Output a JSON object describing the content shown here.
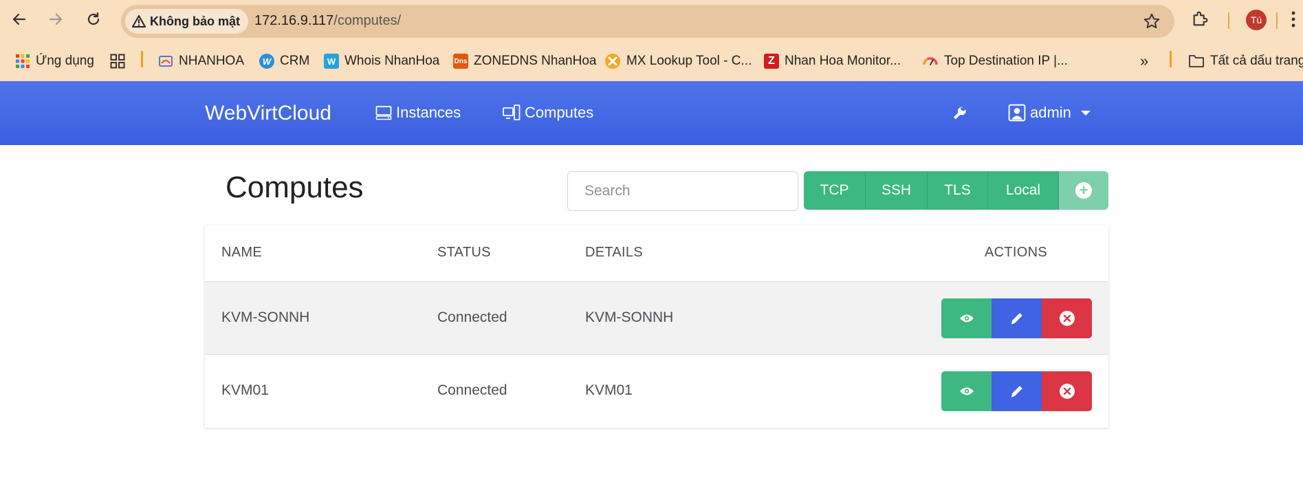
{
  "browser": {
    "security_label": "Không bảo mật",
    "url_host": "172.16.9.117",
    "url_path": "/computes/",
    "profile_initial": "Tú"
  },
  "bookmarks": {
    "items": [
      {
        "label": "Ứng dụng"
      },
      {
        "label": "NHANHOA"
      },
      {
        "label": "CRM"
      },
      {
        "label": "Whois NhanHoa"
      },
      {
        "label": "ZONEDNS NhanHoa",
        "icon_text": "Dns"
      },
      {
        "label": "MX Lookup Tool - C..."
      },
      {
        "label": "Nhan Hoa Monitor...",
        "icon_text": "Z"
      },
      {
        "label": "Top Destination IP |..."
      }
    ],
    "overflow": "»",
    "all_bookmarks": "Tất cả dấu trang"
  },
  "navbar": {
    "brand": "WebVirtCloud",
    "instances": "Instances",
    "computes": "Computes",
    "user": "admin"
  },
  "page": {
    "title": "Computes",
    "search_placeholder": "Search",
    "buttons": [
      "TCP",
      "SSH",
      "TLS",
      "Local"
    ]
  },
  "table": {
    "headers": {
      "name": "NAME",
      "status": "STATUS",
      "details": "DETAILS",
      "actions": "ACTIONS"
    },
    "rows": [
      {
        "name": "KVM-SONNH",
        "status": "Connected",
        "details": "KVM-SONNH"
      },
      {
        "name": "KVM01",
        "status": "Connected",
        "details": "KVM01"
      }
    ]
  },
  "colors": {
    "accent_blue": "#3f63e3",
    "success_green": "#3db880",
    "danger_red": "#dc3545",
    "chrome_bg": "#f8e0c0"
  }
}
